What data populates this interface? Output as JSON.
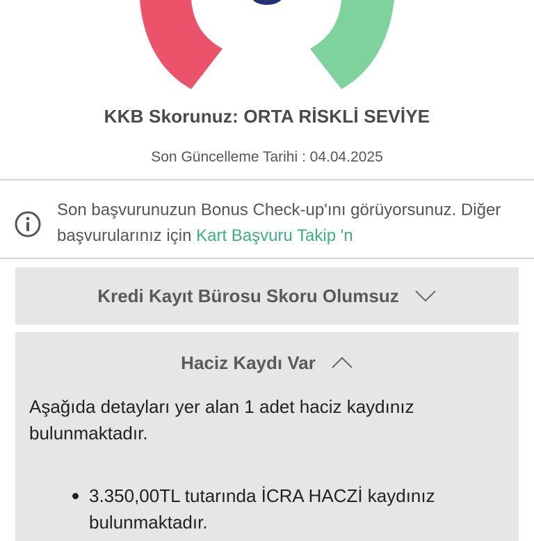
{
  "colors": {
    "gauge_red": "#ec536b",
    "gauge_green": "#7ed29b",
    "needle_navy": "#26307a",
    "link_green": "#3bb07e",
    "accordion_bg": "#e6e6e6"
  },
  "score": {
    "title": "KKB Skorunuz: ORTA RİSKLİ SEVİYE",
    "update_date": "Son Güncelleme Tarihi : 04.04.2025"
  },
  "info": {
    "icon": "info-icon",
    "text": "Son başvurunuzun Bonus Check-up'ını görüyorsunuz. Diğer başvurularınız için",
    "link": "Kart Başvuru Takip 'n"
  },
  "accordions": [
    {
      "title": "Kredi Kayıt Bürosu Skoru Olumsuz",
      "icon": "chevron-down-icon",
      "expanded": false
    },
    {
      "title": "Haciz Kaydı Var",
      "icon": "chevron-up-icon",
      "expanded": true,
      "body": "Aşağıda detayları yer alan 1 adet haciz kaydınız bulunmaktadır.",
      "bullets": [
        "3.350,00TL tutarında İCRA HACZİ kaydınız bulunmaktadır."
      ]
    }
  ]
}
